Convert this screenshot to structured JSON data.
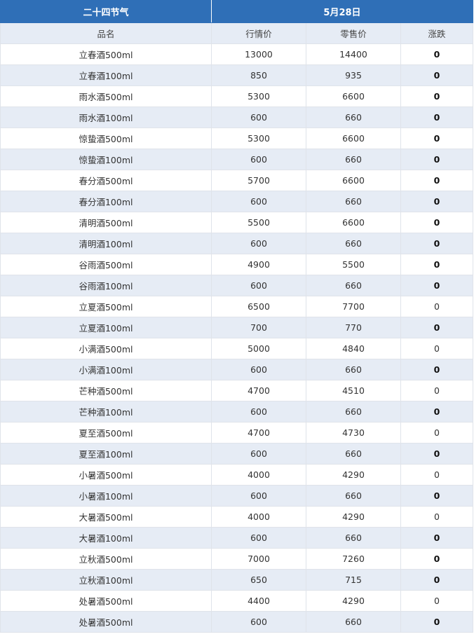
{
  "table": {
    "title_left": "二十四节气",
    "title_right": "5月28日",
    "headers": [
      "品名",
      "行情价",
      "零售价",
      "涨跌"
    ],
    "rows": [
      {
        "name": "立春酒500ml",
        "market": "13000",
        "retail": "14400",
        "change": "0",
        "bold": true
      },
      {
        "name": "立春酒100ml",
        "market": "850",
        "retail": "935",
        "change": "0",
        "bold": true
      },
      {
        "name": "雨水酒500ml",
        "market": "5300",
        "retail": "6600",
        "change": "0",
        "bold": true
      },
      {
        "name": "雨水酒100ml",
        "market": "600",
        "retail": "660",
        "change": "0",
        "bold": true
      },
      {
        "name": "惊蛰酒500ml",
        "market": "5300",
        "retail": "6600",
        "change": "0",
        "bold": true
      },
      {
        "name": "惊蛰酒100ml",
        "market": "600",
        "retail": "660",
        "change": "0",
        "bold": true
      },
      {
        "name": "春分酒500ml",
        "market": "5700",
        "retail": "6600",
        "change": "0",
        "bold": true
      },
      {
        "name": "春分酒100ml",
        "market": "600",
        "retail": "660",
        "change": "0",
        "bold": true
      },
      {
        "name": "清明酒500ml",
        "market": "5500",
        "retail": "6600",
        "change": "0",
        "bold": true
      },
      {
        "name": "清明酒100ml",
        "market": "600",
        "retail": "660",
        "change": "0",
        "bold": true
      },
      {
        "name": "谷雨酒500ml",
        "market": "4900",
        "retail": "5500",
        "change": "0",
        "bold": true
      },
      {
        "name": "谷雨酒100ml",
        "market": "600",
        "retail": "660",
        "change": "0",
        "bold": true
      },
      {
        "name": "立夏酒500ml",
        "market": "6500",
        "retail": "7700",
        "change": "0",
        "bold": false
      },
      {
        "name": "立夏酒100ml",
        "market": "700",
        "retail": "770",
        "change": "0",
        "bold": true
      },
      {
        "name": "小满酒500ml",
        "market": "5000",
        "retail": "4840",
        "change": "0",
        "bold": false
      },
      {
        "name": "小满酒100ml",
        "market": "600",
        "retail": "660",
        "change": "0",
        "bold": true
      },
      {
        "name": "芒种酒500ml",
        "market": "4700",
        "retail": "4510",
        "change": "0",
        "bold": false
      },
      {
        "name": "芒种酒100ml",
        "market": "600",
        "retail": "660",
        "change": "0",
        "bold": true
      },
      {
        "name": "夏至酒500ml",
        "market": "4700",
        "retail": "4730",
        "change": "0",
        "bold": false
      },
      {
        "name": "夏至酒100ml",
        "market": "600",
        "retail": "660",
        "change": "0",
        "bold": true
      },
      {
        "name": "小暑酒500ml",
        "market": "4000",
        "retail": "4290",
        "change": "0",
        "bold": false
      },
      {
        "name": "小暑酒100ml",
        "market": "600",
        "retail": "660",
        "change": "0",
        "bold": true
      },
      {
        "name": "大暑酒500ml",
        "market": "4000",
        "retail": "4290",
        "change": "0",
        "bold": false
      },
      {
        "name": "大暑酒100ml",
        "market": "600",
        "retail": "660",
        "change": "0",
        "bold": true
      },
      {
        "name": "立秋酒500ml",
        "market": "7000",
        "retail": "7260",
        "change": "0",
        "bold": true
      },
      {
        "name": "立秋酒100ml",
        "market": "650",
        "retail": "715",
        "change": "0",
        "bold": true
      },
      {
        "name": "处暑酒500ml",
        "market": "4400",
        "retail": "4290",
        "change": "0",
        "bold": false
      },
      {
        "name": "处暑酒500ml",
        "market": "600",
        "retail": "660",
        "change": "0",
        "bold": true
      }
    ]
  }
}
